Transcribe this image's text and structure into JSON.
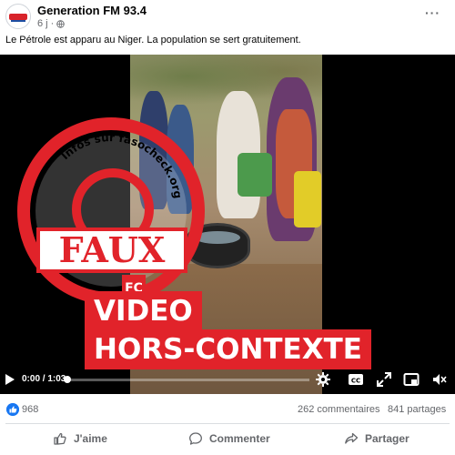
{
  "post": {
    "page_name": "Generation FM 93.4",
    "time_ago": "6 j",
    "separator": "·",
    "more_label": "···",
    "text": "Le Pétrole est apparu au Niger. La population se sert gratuitement."
  },
  "video": {
    "stamp_url_text": "Infos sur fasocheck.org",
    "stamp_word": "FAUX",
    "stamp_logo": "FC",
    "banner_line1": "VIDEO",
    "banner_line2": "HORS-CONTEXTE",
    "time": "0:00 / 1:03",
    "progress": 0,
    "stamp_color": "#e1232a",
    "control_icons": [
      "play-icon",
      "settings-icon",
      "captions-icon",
      "expand-icon",
      "picture-in-picture-icon",
      "volume-icon"
    ]
  },
  "stats": {
    "likes": "968",
    "comments": "262 commentaires",
    "shares": "841 partages"
  },
  "actions": {
    "like": "J'aime",
    "comment": "Commenter",
    "share": "Partager"
  },
  "colors": {
    "brand_blue": "#1877f2",
    "secondary_text": "#65676b",
    "banner_red": "#e1232a"
  }
}
